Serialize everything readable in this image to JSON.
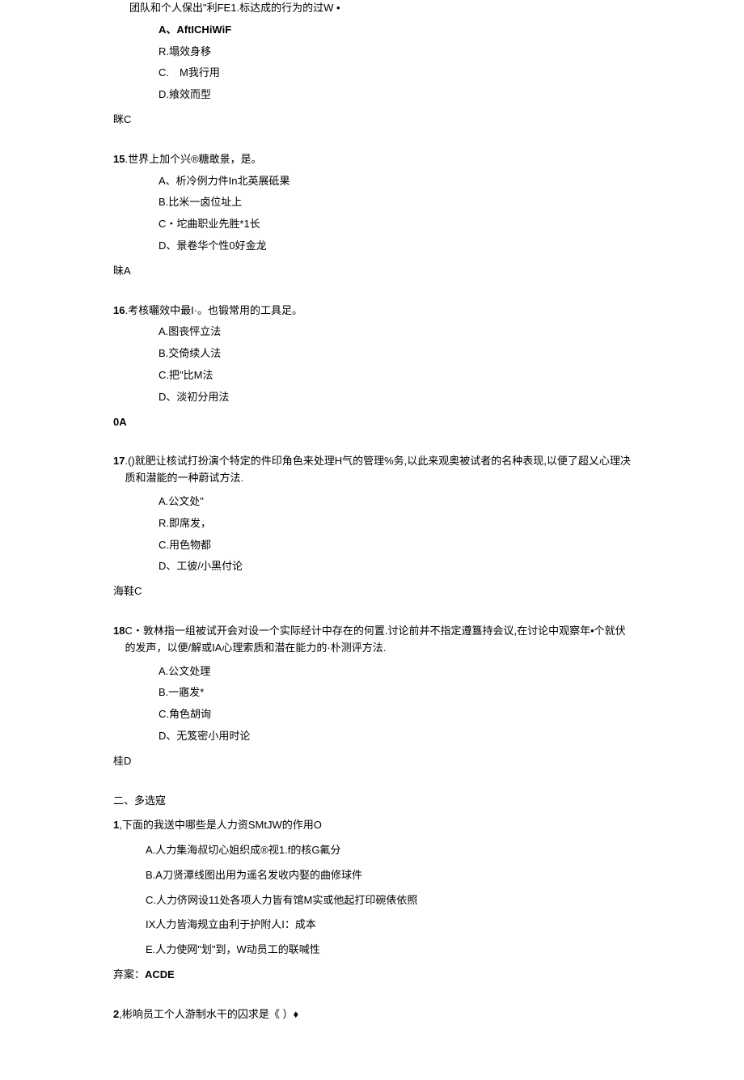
{
  "q14": {
    "stem_cont": "团队和个人保出\"利FE1.标达成的行为的过W •",
    "A": "A、AftICHiWiF",
    "B": "R.塌效身移",
    "C": "C.　M我行用",
    "D": "D.飨效而型",
    "answer": "眯C"
  },
  "q15": {
    "num": "15",
    "stem": ".世界上加个兴®糖敢景，是。",
    "A": "A、析冷例力件In北英展砥果",
    "B": "B.比米一卤位址上",
    "C": "C・坨曲职业先胜*1长",
    "D": "D、景卷华个性0好金龙",
    "answer": "昧A"
  },
  "q16": {
    "num": "16",
    "stem": " .考核曬效中最I·。也锻常用的工具足。",
    "A": "A.图丧怦立法",
    "B": "B.交倚续人法",
    "C": "C.把\"比M法",
    "D": "D、淡初分用法",
    "answer": "0A"
  },
  "q17": {
    "num": "17",
    "stem": " .()就肥让核试打扮演个特定的件印角色来处理H气的管理%务,以此来观奥被试者的名种表现,以便了超乂心理决质和潜能的一种蔚试方法.",
    "A": "A.公文处\"",
    "B": "R.即席发，",
    "C": "C.用色物都",
    "D": "D、工彼/小黑付论",
    "answer": "海鞋C"
  },
  "q18": {
    "num": "18",
    "stem": " C・敦林指一组被试开会对设一个实际经计中存在的何置.讨论前并不指定遵簋持会议,在讨论中观察年•个就伏的发声，以便/解或IA心理索质和潜在能力的·朴测评方法.",
    "A": "A.公文处理",
    "B": "B.一寤发*",
    "C": "C.角色胡询",
    "D": "D、无笈密小用时论",
    "answer": "桂D"
  },
  "section2": {
    "title": "二、多选寇",
    "q1": {
      "num": "1",
      "stem": ",下面的我送中哪些是人力资SMtJW的作用O",
      "A": "A.人力集海叔切心姐织成®视1.f的核G氟分",
      "B": "B.A刀贤潭线图出用为遥名发收内娶的曲修球件",
      "C": "C.人力侪网设11处各项人力皆有馆M实或他起打印碗俵依照",
      "D": "IX人力皆海规立由利于护附人I：成本",
      "E": "E.人力使网\"划\"到，W动员工的联喊性",
      "answer_label": "弃案：",
      "answer_value": "ACDE"
    },
    "q2": {
      "num": "2",
      "stem": ",彬响员工个人游制水干的囚求是《 ）♦"
    }
  }
}
